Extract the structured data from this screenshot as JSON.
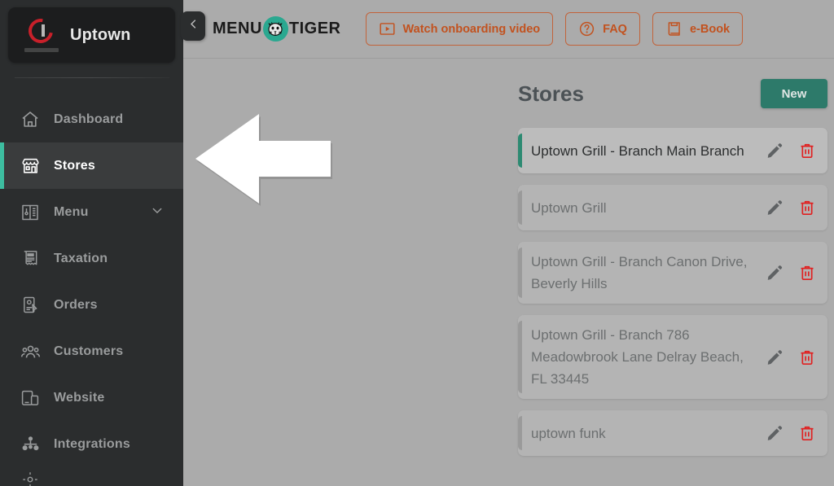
{
  "colors": {
    "page_background": "#ababab",
    "sidebar_background": "#2b2d2e",
    "accent_teal": "#3dbda0",
    "new_button_teal": "#2d7a6a",
    "topbar_orange": "#c2521f",
    "logo_red": "#c8202a",
    "delete_red": "#e02020",
    "mt_badge_teal": "#2aa890"
  },
  "sidebar": {
    "brand": {
      "name": "Uptown",
      "logo_icon": "uptown-grill-logo-icon"
    },
    "items": [
      {
        "label": "Dashboard",
        "icon": "home-icon",
        "active": false,
        "has_chevron": false
      },
      {
        "label": "Stores",
        "icon": "storefront-icon",
        "active": true,
        "has_chevron": false
      },
      {
        "label": "Menu",
        "icon": "menu-book-icon",
        "active": false,
        "has_chevron": true
      },
      {
        "label": "Taxation",
        "icon": "tax-receipt-icon",
        "active": false,
        "has_chevron": false
      },
      {
        "label": "Orders",
        "icon": "orders-icon",
        "active": false,
        "has_chevron": false
      },
      {
        "label": "Customers",
        "icon": "customers-icon",
        "active": false,
        "has_chevron": false
      },
      {
        "label": "Website",
        "icon": "devices-icon",
        "active": false,
        "has_chevron": false
      },
      {
        "label": "Integrations",
        "icon": "integrations-icon",
        "active": false,
        "has_chevron": false
      }
    ],
    "collapse_button_icon": "chevron-left-icon"
  },
  "topbar": {
    "logo": {
      "left_text": "MENU",
      "right_text": "TIGER",
      "badge_icon": "tiger-face-icon"
    },
    "buttons": [
      {
        "label": "Watch onboarding video",
        "icon": "play-video-icon"
      },
      {
        "label": "FAQ",
        "icon": "question-circle-icon"
      },
      {
        "label": "e-Book",
        "icon": "book-icon"
      }
    ]
  },
  "stores": {
    "title": "Stores",
    "new_button_label": "New",
    "edit_icon": "pencil-icon",
    "delete_icon": "trash-icon",
    "rows": [
      {
        "name": "Uptown Grill - Branch Main Branch",
        "selected": true
      },
      {
        "name": "Uptown Grill",
        "selected": false
      },
      {
        "name": "Uptown Grill - Branch Canon Drive, Beverly Hills",
        "selected": false
      },
      {
        "name": "Uptown Grill - Branch 786 Meadowbrook Lane Delray Beach, FL 33445",
        "selected": false
      },
      {
        "name": "uptown funk",
        "selected": false
      }
    ]
  },
  "overlay": {
    "arrow_icon": "arrow-left-pointer",
    "arrow_color": "#ffffff"
  }
}
